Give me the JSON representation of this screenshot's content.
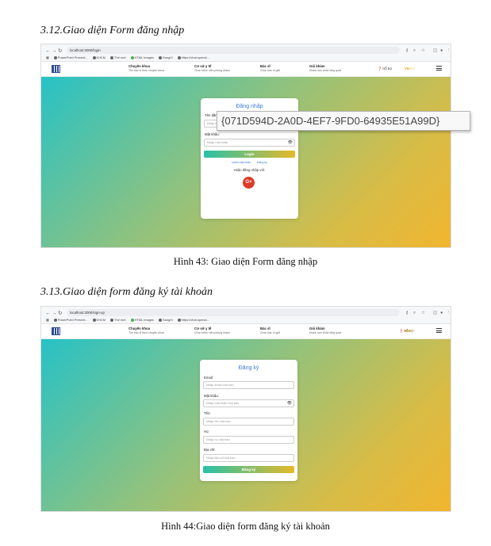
{
  "section1": {
    "heading": "3.12.Giao diện Form đăng nhập",
    "caption": "Hình 43: Giao diện Form đăng nhập",
    "browser": {
      "url": "localhost:3000/login",
      "bookmarks": [
        "PowerPoint Present...",
        "KHCM",
        "Thế mới",
        "HTML Images",
        "SangXi",
        "https://chat.openai..."
      ]
    },
    "site_nav": {
      "items": [
        {
          "title": "Chuyên khoa",
          "sub": "Tìm bác sĩ theo chuyên khoa"
        },
        {
          "title": "Cơ sở y tế",
          "sub": "Chọn bệnh viện phòng khám"
        },
        {
          "title": "Bác sĩ",
          "sub": "Chọn bác sĩ giỏi"
        },
        {
          "title": "Gói khám",
          "sub": "Khám sức khỏe tổng quát"
        }
      ],
      "help": "Hỗ trợ",
      "lang_vn": "VN",
      "lang_en": "EN"
    },
    "form": {
      "title": "Đăng nhập",
      "username_label": "Tên đăng nhập:",
      "username_placeholder": "Nhập tên đăng nhập",
      "password_label": "Mật khẩu:",
      "password_placeholder": "Nhập mật khẩu",
      "login_button": "Login",
      "forgot_link": "Quên mật khẩu",
      "register_link": "Đăng ký",
      "or_text": "Hoặc đăng nhập với:",
      "google_label": "G+"
    },
    "tooltip": "{071D594D-2A0D-4EF7-9FD0-64935E51A99D}"
  },
  "section2": {
    "heading": "3.13.Giao diện form đăng ký tài khoản",
    "caption": "Hình 44:Giao diện form đăng ký tài khoản",
    "browser": {
      "url": "localhost:3000/sign-up",
      "bookmarks": [
        "PowerPoint Present...",
        "KHCM",
        "Thế mới",
        "HTML Images",
        "SangXi",
        "https://chat.openai..."
      ]
    },
    "site_nav": {
      "items": [
        {
          "title": "Chuyên khoa",
          "sub": "Tìm bác sĩ theo chuyên khoa"
        },
        {
          "title": "Cơ sở y tế",
          "sub": "Chọn bệnh viện phòng khám"
        },
        {
          "title": "Bác sĩ",
          "sub": "Chọn bác sĩ giỏi"
        },
        {
          "title": "Gói khám",
          "sub": "Khám sức khỏe tổng quát"
        }
      ],
      "help": "Hỗ trợ",
      "lang_vn": "VN",
      "lang_en": "EN"
    },
    "form": {
      "title": "Đăng ký",
      "email_label": "Email:",
      "email_placeholder": "Nhập email của bạn",
      "password_label": "Mật khẩu:",
      "password_placeholder": "Nhập mật khẩu của bạn",
      "firstname_label": "Tên:",
      "firstname_placeholder": "Nhập tên của bạn",
      "lastname_label": "Họ:",
      "lastname_placeholder": "Nhập họ của bạn",
      "address_label": "Địa chỉ:",
      "address_placeholder": "Nhập địa chỉ của bạn",
      "submit_button": "Đăng ký"
    }
  }
}
